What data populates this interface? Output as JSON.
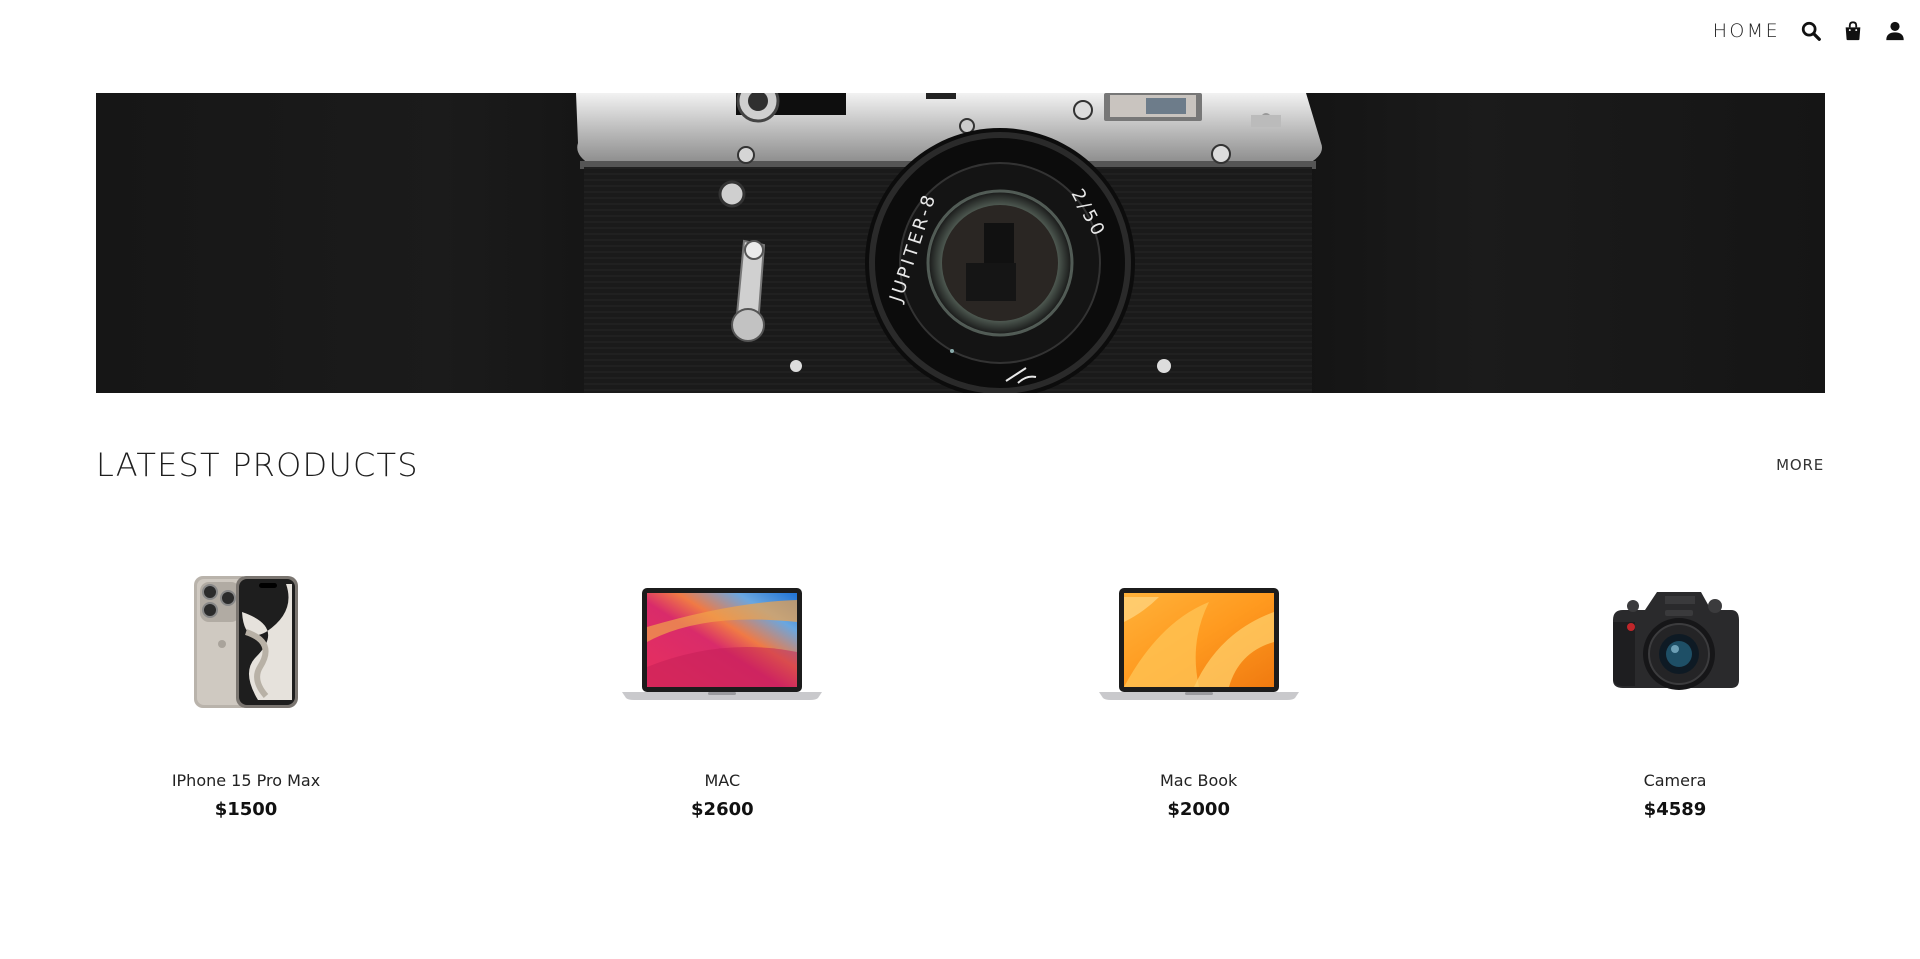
{
  "nav": {
    "home_label": "HOME",
    "icons": [
      "search-icon",
      "shopping-bag-icon",
      "user-icon"
    ]
  },
  "hero": {
    "lens_text_left": "JUPITER-8",
    "lens_text_right": "2/50"
  },
  "latest": {
    "title": "LATEST PRODUCTS",
    "more_label": "MORE"
  },
  "products": [
    {
      "name": "IPhone 15 Pro Max",
      "price": "$1500",
      "image": "iphone"
    },
    {
      "name": "MAC",
      "price": "$2600",
      "image": "macbook-air"
    },
    {
      "name": "Mac Book",
      "price": "$2000",
      "image": "macbook"
    },
    {
      "name": "Camera",
      "price": "$4589",
      "image": "camera"
    }
  ]
}
